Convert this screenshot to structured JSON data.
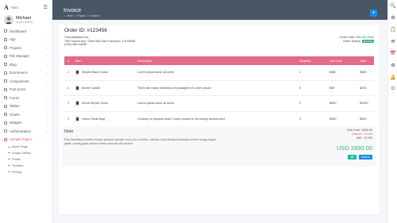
{
  "brand": {
    "logo": "A",
    "name": "Aero"
  },
  "user": {
    "name": "Michael",
    "role": "Super Admin"
  },
  "sidebar": {
    "items": [
      {
        "label": "Dashboard",
        "chevron": false
      },
      {
        "label": "App",
        "chevron": true
      },
      {
        "label": "Projects",
        "chevron": true
      },
      {
        "label": "File Manager",
        "chevron": true
      },
      {
        "label": "Blog",
        "chevron": true
      },
      {
        "label": "Ecommerce",
        "chevron": true
      },
      {
        "label": "Components",
        "chevron": true
      },
      {
        "label": "Font Icons",
        "chevron": true
      },
      {
        "label": "Forms",
        "chevron": true
      },
      {
        "label": "Tables",
        "chevron": true
      },
      {
        "label": "Charts",
        "chevron": true
      },
      {
        "label": "Widgets",
        "chevron": true
      },
      {
        "label": "Authentication",
        "chevron": true
      },
      {
        "label": "Sample Pages",
        "chevron": true
      }
    ],
    "sub_items": [
      "Blank Page",
      "Image Gallery",
      "Profile",
      "Timeline",
      "Pricing"
    ]
  },
  "header": {
    "title": "Invoice",
    "breadcrumb": [
      "Aero",
      "/",
      "Pages",
      "/",
      "Invoice"
    ],
    "add_label": "+"
  },
  "invoice": {
    "order_id": "Order ID: #123456",
    "from_lines": [
      "ThemeMakker Inc.",
      "795 Folsom Ave, Suite 546 San Francisco, CA 54656",
      "(123) 456-34636"
    ],
    "order_date": "Order Date: Dec 03, 2019",
    "order_status_label": "Order Status:",
    "order_status": "Success"
  },
  "table": {
    "headers": [
      "#",
      "Item",
      "Description",
      "Quantity",
      "Unit Cost",
      "Total"
    ],
    "rows": [
      {
        "num": "1",
        "item": "Simple Black Clock",
        "desc": "Lorem ipsum dolor sit amet.",
        "qty": "1",
        "unit": "$380",
        "total": "$380"
      },
      {
        "num": "2",
        "item": "Brone Candle",
        "desc": "There are many variations of passages of Lorem Ipsum",
        "qty": "5",
        "unit": "$50",
        "total": "$250"
      },
      {
        "num": "3",
        "item": "Wood Simple Clock",
        "desc": "Lorem ipsum dolor sit amet.",
        "qty": "2",
        "unit": "$500",
        "total": "$1000"
      },
      {
        "num": "4",
        "item": "Unero Small Bag",
        "desc": "Contrary to popular belief, Lorem Ipsum is not simply random text",
        "qty": "3",
        "unit": "$300",
        "total": "$900"
      }
    ]
  },
  "note": {
    "title": "Note",
    "text": "Etsy doostang zoodles disqus groupon greplin oooj voxy zoodles, weebly ning heekya handango imeem plugg dopplr jibjab, movity jajah plickers sifteo edmodo ifttt zimbra."
  },
  "totals": {
    "sub_total": "Sub-Total : 2930.00",
    "discount": "Discout : 12.9%",
    "vat": "VAT : 12.9%",
    "grand_total": "USD 2930.00",
    "print_label": "🖶",
    "submit_label": "Submit"
  },
  "rightbar": [
    "🔍",
    "⚙",
    "📋",
    "✉",
    "📅",
    "⚙",
    "🔔",
    "⏻"
  ],
  "colors": {
    "header": "#495765",
    "accent": "#e46a8d",
    "primary": "#1e88e5",
    "success": "#2fb573",
    "danger": "#e0524f"
  }
}
